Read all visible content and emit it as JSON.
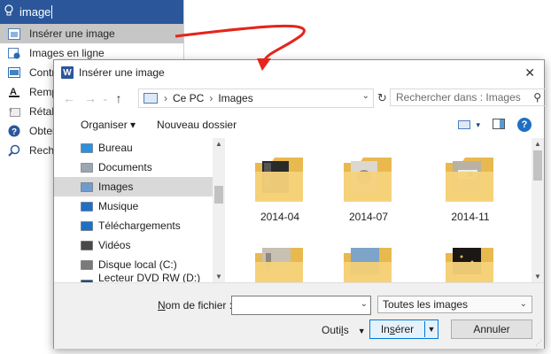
{
  "tellme": {
    "search_value": "image",
    "items": [
      {
        "label": "Insérer une image",
        "icon": "insert-picture-icon",
        "selected": true
      },
      {
        "label": "Images en ligne",
        "icon": "online-pictures-icon",
        "selected": false
      },
      {
        "label": "Contr",
        "icon": "contrast-icon",
        "selected": false
      },
      {
        "label": "Remp",
        "icon": "font-color-icon",
        "selected": false
      },
      {
        "label": "Rétab",
        "icon": "reset-picture-icon",
        "selected": false
      },
      {
        "label": "Obter",
        "icon": "help-icon",
        "selected": false
      },
      {
        "label": "Reche",
        "icon": "smart-lookup-icon",
        "selected": false
      }
    ]
  },
  "dialog": {
    "title": "Insérer une image",
    "close_glyph": "✕",
    "address": {
      "crumbs": [
        "Ce PC",
        "Images"
      ]
    },
    "search_placeholder": "Rechercher dans : Images",
    "toolbar": {
      "organize": "Organiser ▾",
      "new_folder": "Nouveau dossier"
    },
    "nav": [
      {
        "label": "Bureau",
        "icon": "desktop-icon",
        "color": "#2f8fd8",
        "selected": false
      },
      {
        "label": "Documents",
        "icon": "documents-icon",
        "color": "#9aa6b2",
        "selected": false
      },
      {
        "label": "Images",
        "icon": "pictures-icon",
        "color": "#6f9ccf",
        "selected": true
      },
      {
        "label": "Musique",
        "icon": "music-icon",
        "color": "#1f6fc5",
        "selected": false
      },
      {
        "label": "Téléchargements",
        "icon": "downloads-icon",
        "color": "#1f6fc5",
        "selected": false
      },
      {
        "label": "Vidéos",
        "icon": "videos-icon",
        "color": "#4a4a4a",
        "selected": false
      },
      {
        "label": "Disque local (C:)",
        "icon": "local-disk-icon",
        "color": "#7a7a7a",
        "selected": false
      },
      {
        "label": "Lecteur DVD RW (D:) Blueb",
        "icon": "dvd-drive-icon",
        "color": "#1f4e8c",
        "selected": false
      }
    ],
    "folders": [
      {
        "name": "2014-04",
        "preview": "dark"
      },
      {
        "name": "2014-07",
        "preview": "light"
      },
      {
        "name": "2014-11",
        "preview": "photo"
      },
      {
        "name": "",
        "preview": "building"
      },
      {
        "name": "",
        "preview": "sky"
      },
      {
        "name": "",
        "preview": "night"
      }
    ],
    "filename_label_underlined": "N",
    "filename_label_rest": "om de fichier :",
    "filename_value": "",
    "file_type": "Toutes les images",
    "tools_label_pre": "Outi",
    "tools_label_u": "l",
    "tools_label_post": "s",
    "insert_pre": "In",
    "insert_u": "s",
    "insert_post": "érer",
    "cancel_label": "Annuler"
  },
  "colors": {
    "word_blue": "#2b579a",
    "arrow_red": "#e5241b",
    "folder_yellow": "#f5d27a",
    "accent": "#0078d7"
  }
}
